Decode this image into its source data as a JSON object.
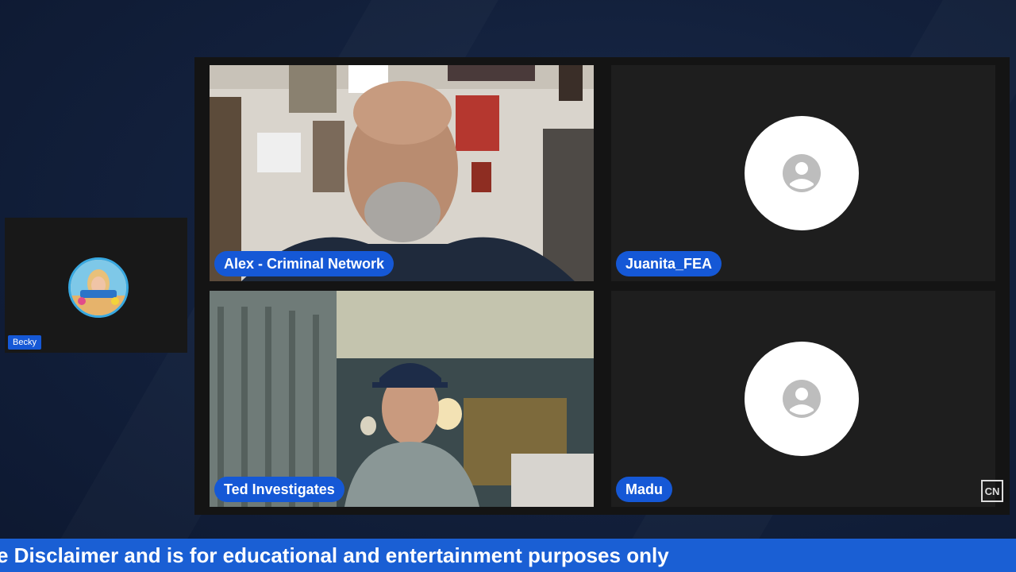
{
  "participants": {
    "alex": {
      "name": "Alex - Criminal Network"
    },
    "juanita": {
      "name": "Juanita_FEA"
    },
    "ted": {
      "name": "Ted Investigates"
    },
    "madu": {
      "name": "Madu"
    },
    "becky": {
      "name": "Becky"
    }
  },
  "ticker": {
    "text": "e Disclaimer and is for educational and entertainment purposes only"
  },
  "colors": {
    "name_tag": "#1558d6",
    "ticker_bg": "#1a5fd4",
    "stage_bg": "#141414"
  },
  "icons": {
    "avatar": "person-placeholder-icon",
    "logo": "channel-logo"
  }
}
